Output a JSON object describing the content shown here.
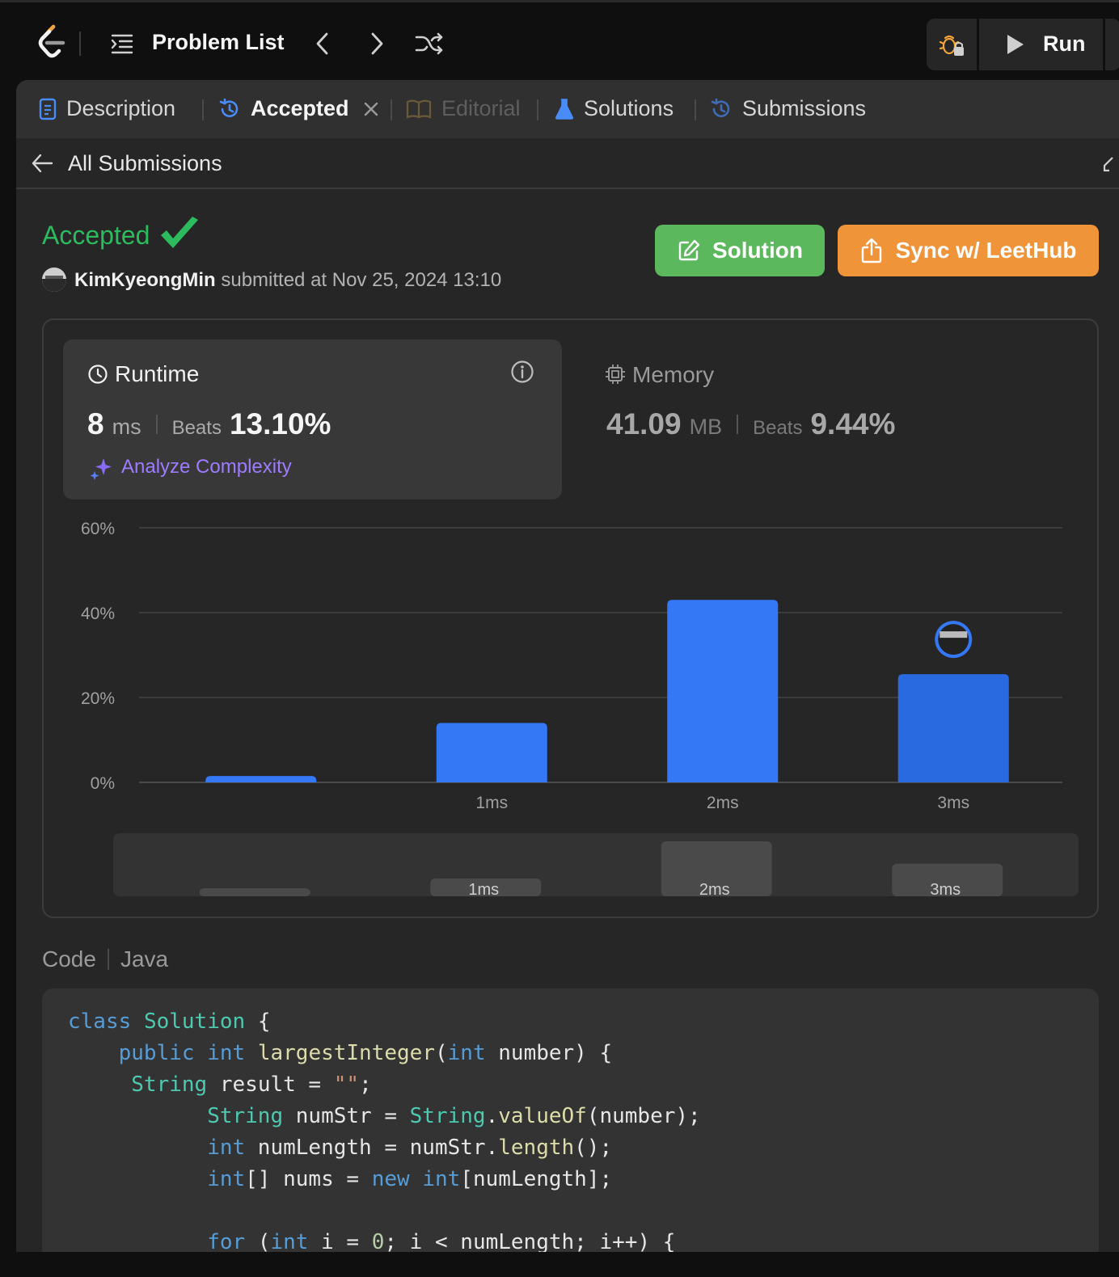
{
  "topbar": {
    "problem_list": "Problem List",
    "run_label": "Run"
  },
  "tabs": [
    {
      "label": "Description",
      "state": "normal"
    },
    {
      "label": "Accepted",
      "state": "active"
    },
    {
      "label": "Editorial",
      "state": "disabled"
    },
    {
      "label": "Solutions",
      "state": "normal"
    },
    {
      "label": "Submissions",
      "state": "normal"
    }
  ],
  "subbar": {
    "all_submissions": "All Submissions"
  },
  "result": {
    "status": "Accepted",
    "username": "KimKyeongMin",
    "submitted_text": "submitted at Nov 25, 2024 13:10",
    "solution_button": "Solution",
    "sync_button": "Sync w/ LeetHub"
  },
  "runtime": {
    "title": "Runtime",
    "value": "8",
    "unit": "ms",
    "beats_label": "Beats",
    "beats_value": "13.10%",
    "analyze": "Analyze Complexity"
  },
  "memory": {
    "title": "Memory",
    "value": "41.09",
    "unit": "MB",
    "beats_label": "Beats",
    "beats_value": "9.44%"
  },
  "chart_data": {
    "type": "bar",
    "categories": [
      "",
      "1ms",
      "2ms",
      "3ms"
    ],
    "values": [
      1.5,
      14,
      43,
      25.5
    ],
    "ylim": [
      0,
      60
    ],
    "yticks": [
      "0%",
      "20%",
      "40%",
      "60%"
    ],
    "ytick_values": [
      0,
      20,
      40,
      60
    ],
    "bar_color": "#3478f6",
    "highlight_index": 3,
    "grid": true,
    "overview_values": [
      1.5,
      14,
      43,
      25.5
    ]
  },
  "code": {
    "label": "Code",
    "language": "Java",
    "lines": [
      "class Solution {",
      "    public int largestInteger(int number) {",
      "     String result = \"\";",
      "           String numStr = String.valueOf(number);",
      "           int numLength = numStr.length();",
      "           int[] nums = new int[numLength];",
      "",
      "           for (int i = 0; i < numLength; i++) {"
    ]
  },
  "colors": {
    "accepted": "#2cbb5d",
    "solution_btn": "#5cb85c",
    "sync_btn": "#f0943a",
    "accent_blue": "#3478f6",
    "analyze": "#9e7bff"
  }
}
